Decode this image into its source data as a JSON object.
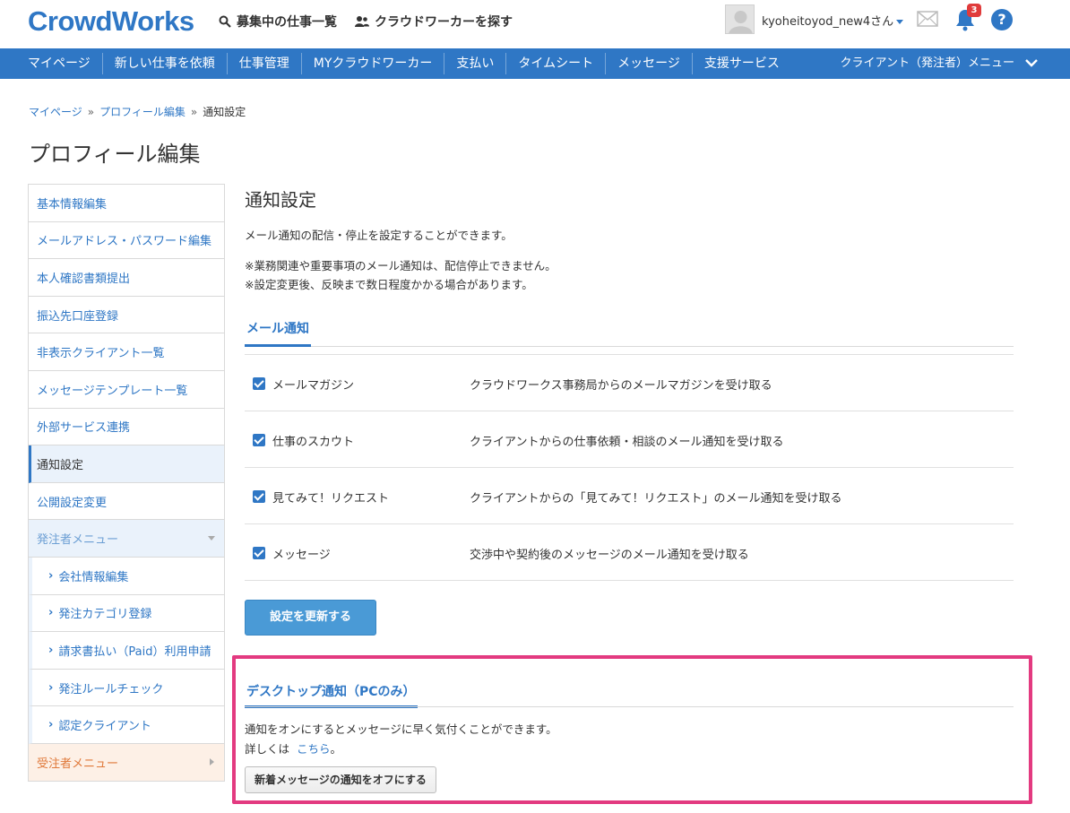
{
  "header": {
    "logo": "CrowdWorks",
    "links": [
      {
        "label": "募集中の仕事一覧",
        "icon": "search-icon"
      },
      {
        "label": "クラウドワーカーを探す",
        "icon": "people-icon"
      }
    ],
    "username": "kyoheitoyod_new4さん",
    "notification_count": "3",
    "help_label": "?"
  },
  "nav": {
    "items": [
      "マイページ",
      "新しい仕事を依頼",
      "仕事管理",
      "MYクラウドワーカー",
      "支払い",
      "タイムシート",
      "メッセージ",
      "支援サービス"
    ],
    "right_menu": "クライアント（発注者）メニュー"
  },
  "breadcrumb": {
    "items": [
      "マイページ",
      "プロフィール編集",
      "通知設定"
    ],
    "separator": "»"
  },
  "page_title": "プロフィール編集",
  "sidebar": {
    "items": [
      {
        "label": "基本情報編集"
      },
      {
        "label": "メールアドレス・パスワード編集"
      },
      {
        "label": "本人確認書類提出"
      },
      {
        "label": "振込先口座登録"
      },
      {
        "label": "非表示クライアント一覧"
      },
      {
        "label": "メッセージテンプレート一覧"
      },
      {
        "label": "外部サービス連携"
      },
      {
        "label": "通知設定"
      },
      {
        "label": "公開設定変更"
      }
    ],
    "client_group": "発注者メニュー",
    "client_sub": [
      "会社情報編集",
      "発注カテゴリ登録",
      "請求書払い（Paid）利用申請",
      "発注ルールチェック",
      "認定クライアント"
    ],
    "worker_group": "受注者メニュー"
  },
  "main": {
    "title": "通知設定",
    "desc1": "メール通知の配信・停止を設定することができます。",
    "note1": "※業務関連や重要事項のメール通知は、配信停止できません。",
    "note2": "※設定変更後、反映まで数日程度かかる場合があります。",
    "tab": "メール通知",
    "rows": [
      {
        "label": "メールマガジン",
        "desc": "クラウドワークス事務局からのメールマガジンを受け取る"
      },
      {
        "label": "仕事のスカウト",
        "desc": "クライアントからの仕事依頼・相談のメール通知を受け取る"
      },
      {
        "label": "見てみて！リクエスト",
        "desc": "クライアントからの「見てみて！リクエスト」のメール通知を受け取る"
      },
      {
        "label": "メッセージ",
        "desc": "交渉中や契約後のメッセージのメール通知を受け取る"
      }
    ],
    "update_button": "設定を更新する"
  },
  "desktop": {
    "title": "デスクトップ通知（PCのみ）",
    "text1": "通知をオンにするとメッセージに早く気付くことができます。",
    "text2_prefix": "詳しくは",
    "text2_link": "こちら",
    "text2_suffix": "。",
    "button": "新着メッセージの通知をオフにする"
  },
  "colors": {
    "brand": "#2f77c5",
    "highlight": "#e33a80",
    "badge": "#e03b3b"
  }
}
